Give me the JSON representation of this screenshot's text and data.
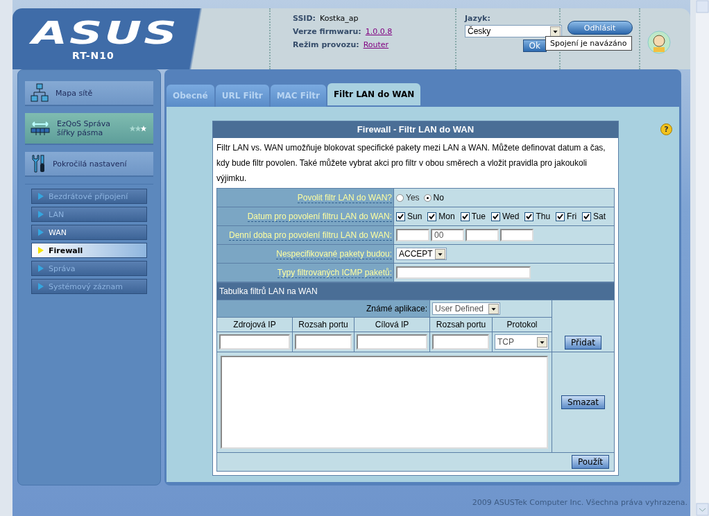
{
  "header": {
    "logo": "ASUS",
    "model": "RT-N10",
    "ssid_label": "SSID:",
    "ssid": "Kostka_ap",
    "firmware_label": "Verze firmwaru:",
    "firmware": "1.0.0.8",
    "mode_label": "Režim provozu:",
    "mode": "Router",
    "language_label": "Jazyk:",
    "language": "Česky",
    "ok_button": "Ok",
    "logout_button": "Odhlásit",
    "status_tooltip": "Spojení je navázáno"
  },
  "sidebar": {
    "main_items": [
      {
        "label": "Mapa sítě",
        "kind": "network"
      },
      {
        "label": "EzQoS Správa šířky pásma",
        "kind": "qos"
      },
      {
        "label": "Pokročilá nastavení",
        "kind": "tools"
      }
    ],
    "sub_items": [
      {
        "label": "Bezdrátové připojení",
        "selected": false,
        "disabled": true
      },
      {
        "label": "LAN",
        "selected": false,
        "disabled": true
      },
      {
        "label": "WAN",
        "selected": false,
        "disabled": false
      },
      {
        "label": "Firewall",
        "selected": true,
        "disabled": false
      },
      {
        "label": "Správa",
        "selected": false,
        "disabled": true
      },
      {
        "label": "Systémový záznam",
        "selected": false,
        "disabled": true
      }
    ]
  },
  "tabs": [
    {
      "label": "Obecné",
      "selected": false
    },
    {
      "label": "URL Filtr",
      "selected": false
    },
    {
      "label": "MAC Filtr",
      "selected": false
    },
    {
      "label": "Filtr LAN do WAN",
      "selected": true
    }
  ],
  "help": "?",
  "form": {
    "title": "Firewall - Filtr LAN do WAN",
    "description": "Filtr LAN vs. WAN umožňuje blokovat specifické pakety mezi LAN a WAN. Můžete definovat datum a čas, kdy bude filtr povolen. Také můžete vybrat akci pro filtr v obou směrech a vložit pravidla pro jakoukoli výjimku.",
    "rows": [
      {
        "label": "Povolit filtr LAN do WAN?",
        "kind": "radio",
        "options": [
          {
            "label": "Yes",
            "selected": false
          },
          {
            "label": "No",
            "selected": true
          }
        ]
      },
      {
        "label": "Datum pro povolení filtru LAN do WAN:",
        "kind": "days",
        "days": [
          {
            "label": "Sun",
            "checked": true
          },
          {
            "label": "Mon",
            "checked": true
          },
          {
            "label": "Tue",
            "checked": true
          },
          {
            "label": "Wed",
            "checked": true
          },
          {
            "label": "Thu",
            "checked": true
          },
          {
            "label": "Fri",
            "checked": true
          },
          {
            "label": "Sat",
            "checked": true
          }
        ]
      },
      {
        "label": "Denní doba pro povolení filtru LAN do WAN:",
        "kind": "time",
        "fields": [
          {
            "kind": "blank"
          },
          {
            "kind": "filled",
            "value": "00"
          },
          {
            "kind": "blank"
          },
          {
            "kind": "blank"
          }
        ]
      },
      {
        "label": "Nespecifikované pakety budou:",
        "kind": "select",
        "value": "ACCEPT"
      },
      {
        "label": "Typy filtrovaných ICMP paketů:",
        "kind": "text"
      }
    ],
    "table": {
      "title": "Tabulka filtrů LAN na WAN",
      "apps_label": "Známé aplikace:",
      "apps_value": "User Defined",
      "columns": [
        "Zdrojová IP",
        "Rozsah portu",
        "Cílová IP",
        "Rozsah portu",
        "Protokol"
      ],
      "protocol": "TCP",
      "add_button": "Přidat",
      "delete_button": "Smazat"
    },
    "apply_button": "Použít"
  },
  "footer": "2009 ASUSTek Computer Inc. Všechna práva vyhrazena."
}
